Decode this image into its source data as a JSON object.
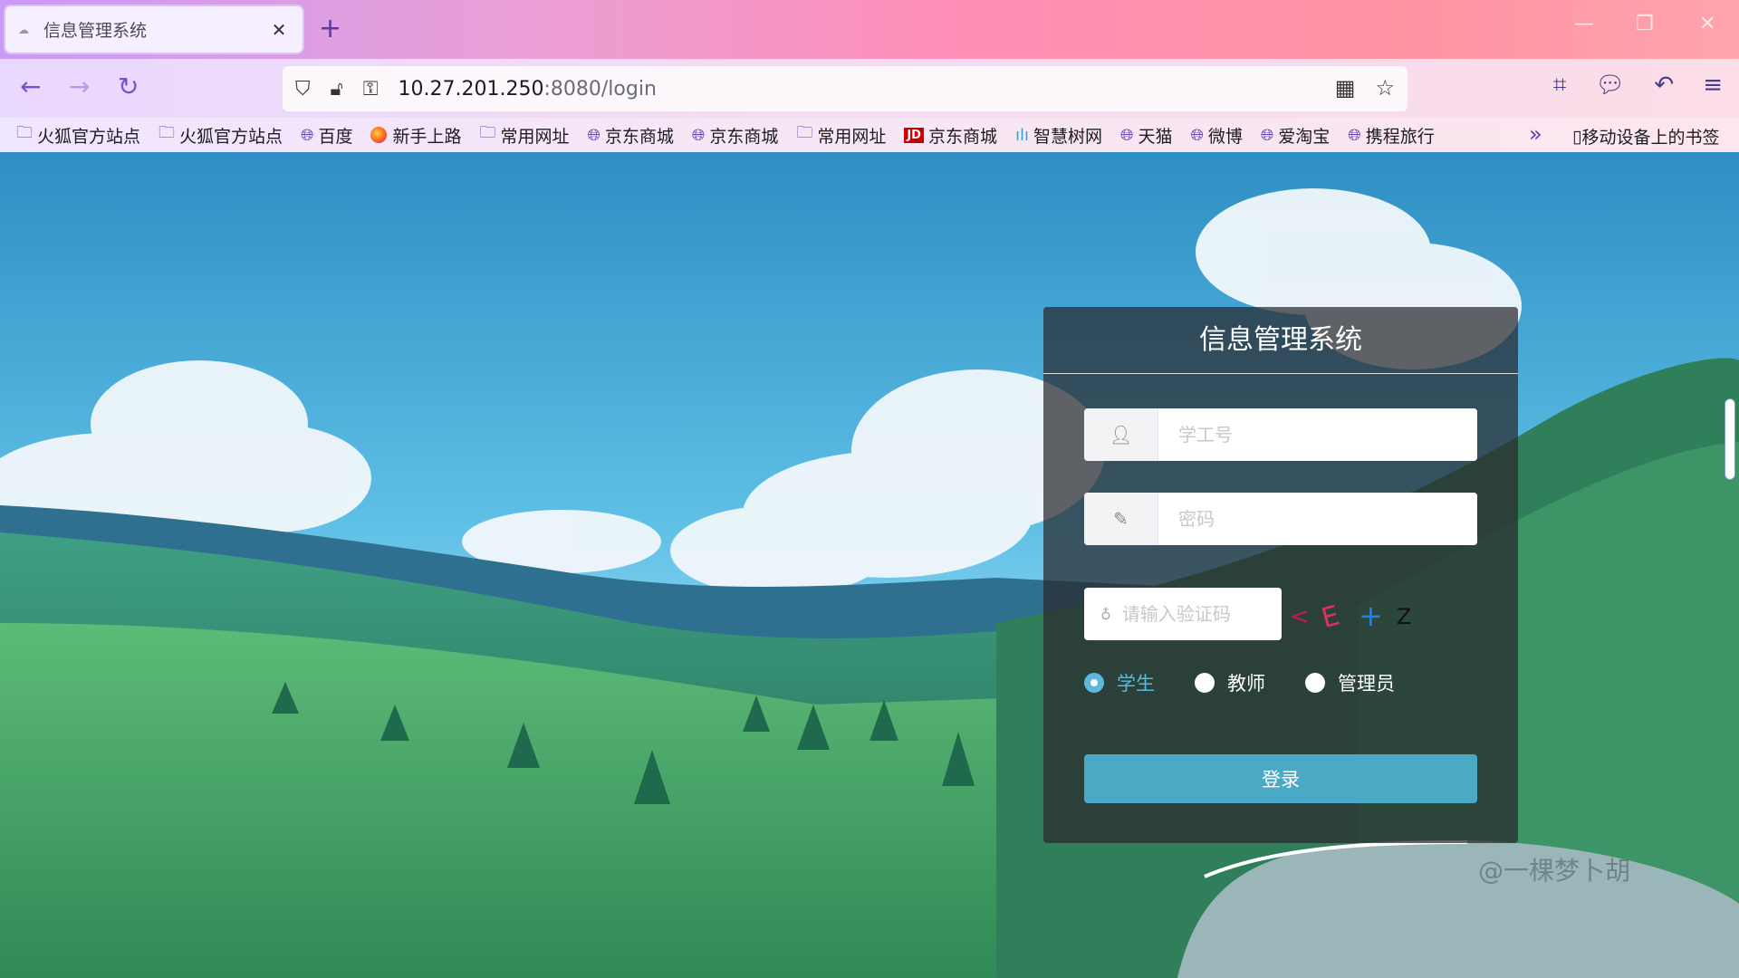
{
  "browser": {
    "tab_title": "信息管理系统",
    "url_host": "10.27.201.250",
    "url_rest": ":8080/login",
    "bookmarks": [
      {
        "label": "火狐官方站点",
        "icon": "folder-icon"
      },
      {
        "label": "火狐官方站点",
        "icon": "folder-icon"
      },
      {
        "label": "百度",
        "icon": "globe-icon"
      },
      {
        "label": "新手上路",
        "icon": "firefox-icon"
      },
      {
        "label": "常用网址",
        "icon": "folder-icon"
      },
      {
        "label": "京东商城",
        "icon": "globe-icon"
      },
      {
        "label": "京东商城",
        "icon": "globe-icon"
      },
      {
        "label": "常用网址",
        "icon": "folder-icon"
      },
      {
        "label": "京东商城",
        "icon": "jd-icon"
      },
      {
        "label": "智慧树网",
        "icon": "zhihuishu-icon"
      },
      {
        "label": "天猫",
        "icon": "globe-icon"
      },
      {
        "label": "微博",
        "icon": "globe-icon"
      },
      {
        "label": "爱淘宝",
        "icon": "globe-icon"
      },
      {
        "label": "携程旅行",
        "icon": "globe-icon"
      }
    ],
    "mobile_bookmarks": "移动设备上的书签"
  },
  "login": {
    "title": "信息管理系统",
    "username_placeholder": "学工号",
    "password_placeholder": "密码",
    "captcha_placeholder": "请输入验证码",
    "captcha_chars": [
      "<",
      "E",
      "+",
      "Z"
    ],
    "roles": [
      {
        "label": "学生",
        "checked": true
      },
      {
        "label": "教师",
        "checked": false
      },
      {
        "label": "管理员",
        "checked": false
      }
    ],
    "submit_label": "登录",
    "watermark": "@一棵梦卜胡"
  },
  "colors": {
    "accent": "#4aa9c4",
    "radio_checked": "#5cb8dc"
  }
}
